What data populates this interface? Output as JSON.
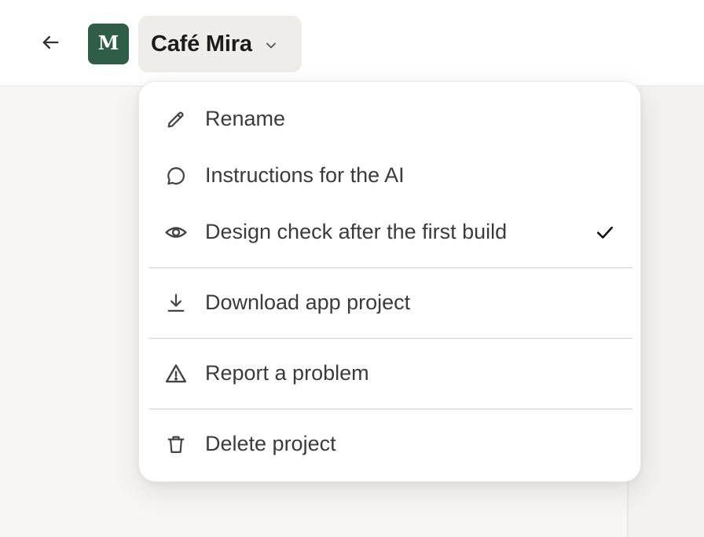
{
  "header": {
    "back_icon": "arrow-left-icon",
    "avatar_letter": "M",
    "avatar_color": "#2f5d47",
    "project_name": "Café Mira",
    "dropdown_icon": "chevron-down-icon"
  },
  "menu": {
    "items": [
      {
        "label": "Rename",
        "icon": "pencil-icon"
      },
      {
        "label": "Instructions for the AI",
        "icon": "speech-bubble-icon"
      },
      {
        "label": "Design check after the first build",
        "icon": "eye-icon",
        "checked": true
      },
      {
        "label": "Download app project",
        "icon": "download-icon"
      },
      {
        "label": "Report a problem",
        "icon": "warning-triangle-icon"
      },
      {
        "label": "Delete project",
        "icon": "trash-icon"
      }
    ]
  }
}
